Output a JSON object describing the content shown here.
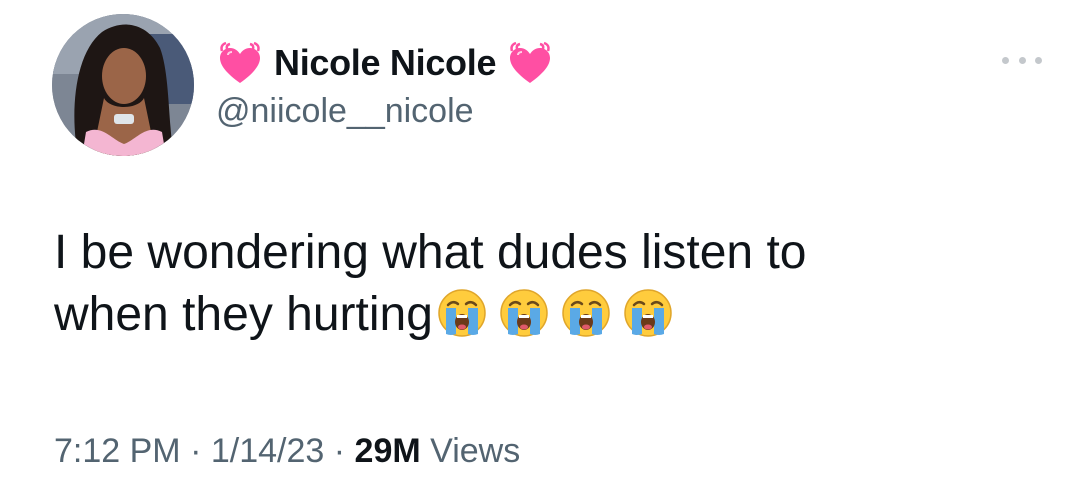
{
  "author": {
    "display_name": "Nicole Nicole",
    "handle": "@niicole__nicole",
    "name_icon": "beating-pink-heart-icon"
  },
  "tweet": {
    "text_line1": "I be wondering what dudes listen to",
    "text_line2": "when they hurting",
    "emojis": [
      "loudly-crying-face",
      "loudly-crying-face",
      "loudly-crying-face",
      "loudly-crying-face"
    ]
  },
  "meta": {
    "time": "7:12 PM",
    "separator": "·",
    "date": "1/14/23",
    "views_count": "29M",
    "views_label": "Views"
  },
  "menu": {
    "icon": "more-horizontal-icon"
  },
  "colors": {
    "text": "#0f1419",
    "secondary": "#536471",
    "heart": "#ff4fa3",
    "emoji": "#ffcc3d",
    "tears": "#5aa9e6"
  }
}
